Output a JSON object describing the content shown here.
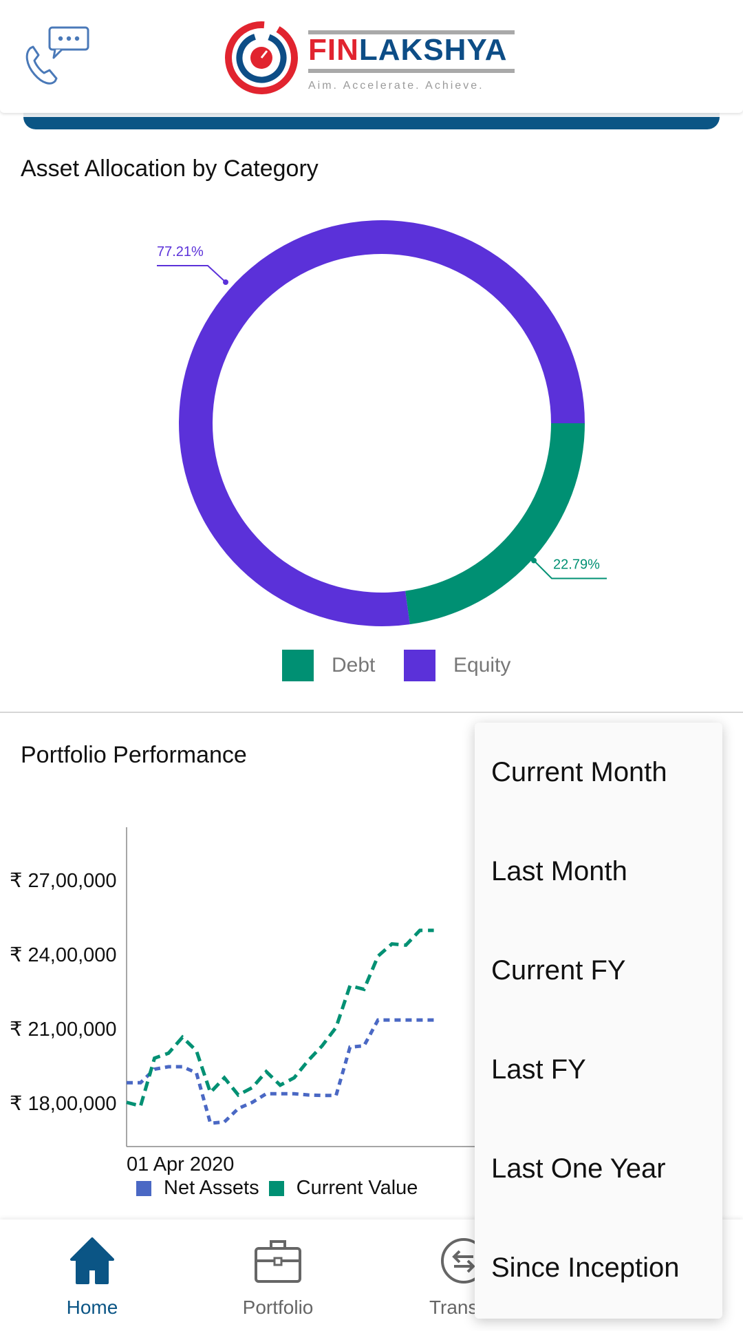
{
  "header": {
    "brand_fin": "FIN",
    "brand_rest": "LAKSHYA",
    "tagline": "Aim. Accelerate. Achieve.",
    "support_icon": "phone-chat-icon"
  },
  "allocation": {
    "title": "Asset Allocation by Category"
  },
  "performance": {
    "title": "Portfolio Performance"
  },
  "colors": {
    "equity": "#5b31d9",
    "debt": "#009073",
    "net_assets": "#4a68c4",
    "current_value": "#009073",
    "brand_blue": "#0b5585",
    "brand_red": "#e1242f"
  },
  "period_menu": {
    "items": [
      "Current Month",
      "Last Month",
      "Current FY",
      "Last FY",
      "Last One Year",
      "Since Inception"
    ]
  },
  "bottom_nav": {
    "items": [
      {
        "label": "Home",
        "icon": "home-icon",
        "active": true
      },
      {
        "label": "Portfolio",
        "icon": "briefcase-icon",
        "active": false
      },
      {
        "label": "Transac",
        "icon": "transactions-icon",
        "active": false
      }
    ]
  },
  "chart_data": [
    {
      "type": "pie",
      "variant": "donut",
      "title": "Asset Allocation by Category",
      "categories": [
        "Debt",
        "Equity"
      ],
      "values": [
        22.79,
        77.21
      ],
      "labels": [
        "22.79%",
        "77.21%"
      ],
      "legend": [
        "Debt",
        "Equity"
      ],
      "legend_position": "bottom"
    },
    {
      "type": "line",
      "title": "Portfolio Performance",
      "xlabel": "",
      "ylabel": "",
      "x_tick_labels": [
        "01 Apr 2020"
      ],
      "y_tick_labels": [
        "₹ 18,00,000",
        "₹ 21,00,000",
        "₹ 24,00,000",
        "₹ 27,00,000"
      ],
      "y_ticks": [
        1800000,
        2100000,
        2400000,
        2700000
      ],
      "ylim": [
        1630000,
        2930000
      ],
      "x_points": 23,
      "legend_position": "bottom",
      "series": [
        {
          "name": "Net Assets",
          "values": [
            1890000,
            1890000,
            1945000,
            1955000,
            1955000,
            1930000,
            1725000,
            1730000,
            1785000,
            1810000,
            1845000,
            1845000,
            1845000,
            1840000,
            1838000,
            1838000,
            2035000,
            2040000,
            2145000,
            2145000,
            2145000,
            2145000,
            2145000
          ]
        },
        {
          "name": "Current Value",
          "values": [
            1810000,
            1795000,
            1990000,
            2010000,
            2075000,
            2020000,
            1850000,
            1910000,
            1840000,
            1870000,
            1935000,
            1880000,
            1910000,
            1980000,
            2040000,
            2115000,
            2285000,
            2270000,
            2405000,
            2455000,
            2450000,
            2510000,
            2510000
          ]
        }
      ]
    }
  ]
}
